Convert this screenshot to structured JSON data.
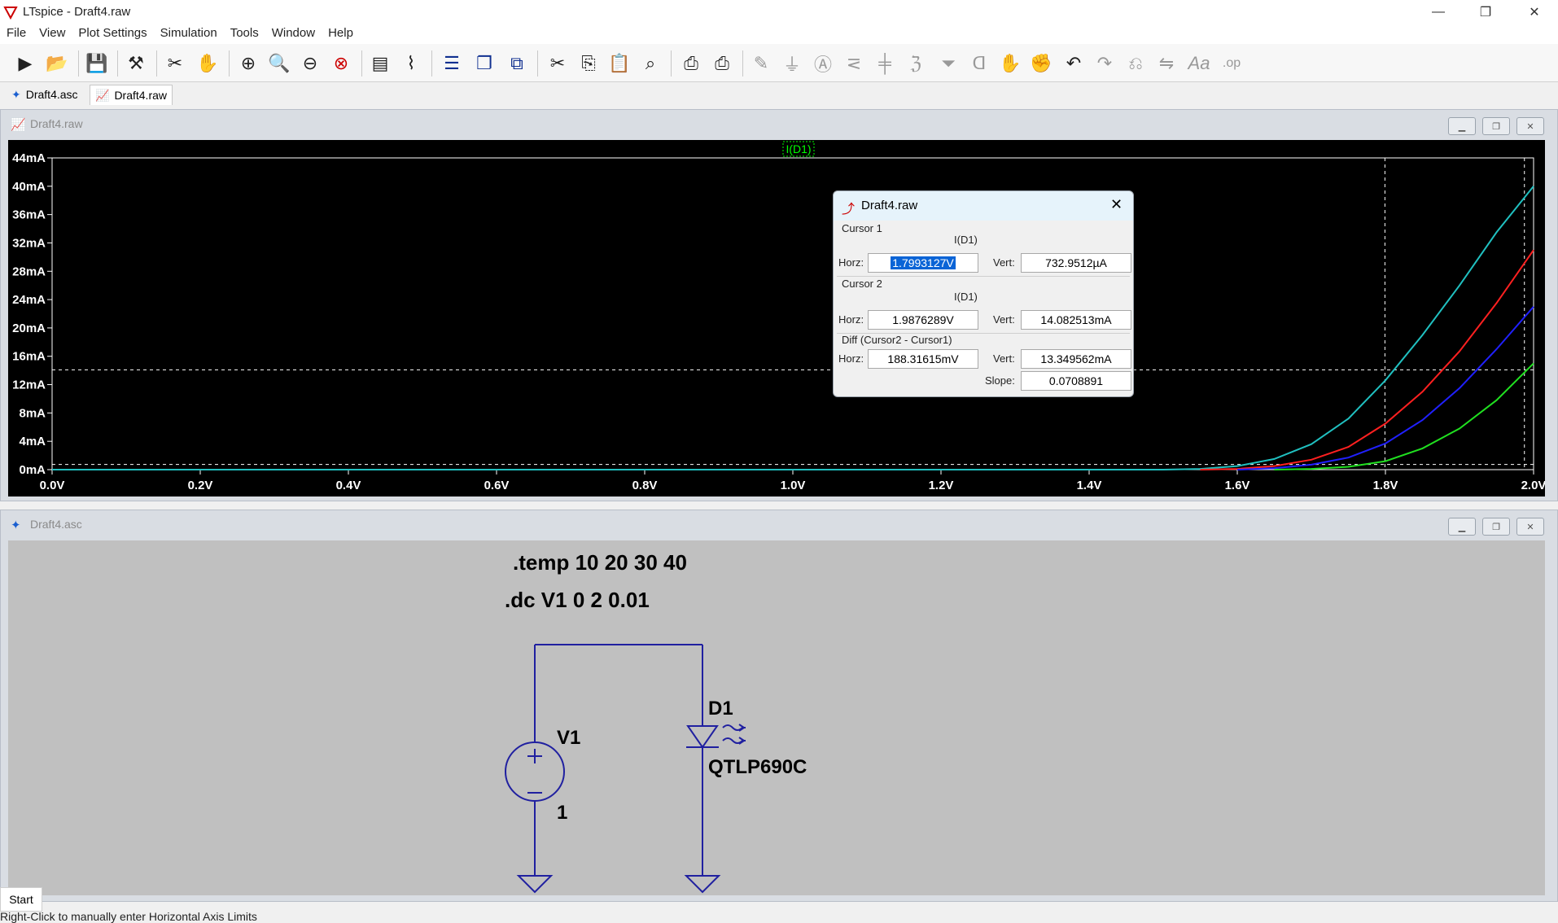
{
  "window": {
    "title": "LTspice - Draft4.raw",
    "controls": [
      "—",
      "❐",
      "✕"
    ]
  },
  "menu": [
    "File",
    "View",
    "Plot Settings",
    "Simulation",
    "Tools",
    "Window",
    "Help"
  ],
  "toolbar_icons": [
    "run-icon",
    "open-icon",
    "save-icon",
    "control-panel-icon",
    "halt-icon",
    "pan-icon",
    "zoom-in-icon",
    "zoom-area-icon",
    "zoom-out-icon",
    "zoom-fit-icon",
    "autorange-icon",
    "waveform-icon",
    "tile-horizontal-icon",
    "cascade-icon",
    "tile-vertical-icon",
    "cut-icon",
    "copy-icon",
    "paste-icon",
    "find-icon",
    "print-icon",
    "print-setup-icon",
    "wire-icon",
    "ground-icon",
    "label-icon",
    "resistor-icon",
    "capacitor-icon",
    "inductor-icon",
    "diode-icon",
    "component-icon",
    "move-icon",
    "drag-icon",
    "undo-icon",
    "redo-icon",
    "rotate-icon",
    "mirror-icon",
    "text-icon",
    "spice-directive-icon"
  ],
  "tabs": [
    {
      "label": "Draft4.asc",
      "active": false
    },
    {
      "label": "Draft4.raw",
      "active": true
    }
  ],
  "plot_window": {
    "title": "Draft4.raw",
    "trace_label": "I(D1)",
    "colors": {
      "bg": "#000000",
      "axis": "#ffffff",
      "cursor": "#ffffff",
      "label": "#00ff00"
    }
  },
  "chart_data": {
    "type": "line",
    "xlabel": "",
    "ylabel": "",
    "x_ticks": [
      "0.0V",
      "0.2V",
      "0.4V",
      "0.6V",
      "0.8V",
      "1.0V",
      "1.2V",
      "1.4V",
      "1.6V",
      "1.8V",
      "2.0V"
    ],
    "y_ticks": [
      "0mA",
      "4mA",
      "8mA",
      "12mA",
      "16mA",
      "20mA",
      "24mA",
      "28mA",
      "32mA",
      "36mA",
      "40mA",
      "44mA"
    ],
    "xlim": [
      0,
      2.0
    ],
    "ylim": [
      0,
      44
    ],
    "series": [
      {
        "color": "#20c0c0",
        "x": [
          1.5,
          1.55,
          1.6,
          1.65,
          1.7,
          1.75,
          1.8,
          1.85,
          1.9,
          1.95,
          2.0
        ],
        "y": [
          0,
          0.1,
          0.5,
          1.5,
          3.6,
          7.2,
          12.6,
          19.0,
          26.0,
          33.5,
          40.0
        ]
      },
      {
        "color": "#ff2020",
        "x": [
          1.55,
          1.6,
          1.65,
          1.7,
          1.75,
          1.8,
          1.85,
          1.9,
          1.95,
          2.0
        ],
        "y": [
          0,
          0.1,
          0.5,
          1.4,
          3.2,
          6.5,
          11.0,
          16.7,
          23.5,
          31.0
        ]
      },
      {
        "color": "#2020ff",
        "x": [
          1.6,
          1.65,
          1.7,
          1.75,
          1.8,
          1.85,
          1.9,
          1.95,
          2.0
        ],
        "y": [
          0,
          0.2,
          0.7,
          1.7,
          3.7,
          7.0,
          11.5,
          17.0,
          23.0
        ]
      },
      {
        "color": "#20e020",
        "x": [
          1.65,
          1.7,
          1.75,
          1.8,
          1.85,
          1.9,
          1.95,
          2.0
        ],
        "y": [
          0,
          0.1,
          0.4,
          1.2,
          3.0,
          5.8,
          9.8,
          15.0
        ]
      }
    ],
    "cursor1": {
      "x": 1.7993127,
      "y": 0.7329512
    },
    "cursor2": {
      "x": 1.9876289,
      "y": 14.082513
    },
    "grid": false
  },
  "cursor_dialog": {
    "title": "Draft4.raw",
    "cursor1_label": "Cursor 1",
    "cursor2_label": "Cursor 2",
    "trace": "I(D1)",
    "diff_label": "Diff (Cursor2 - Cursor1)",
    "horz_label": "Horz:",
    "vert_label": "Vert:",
    "slope_label": "Slope:",
    "c1_horz": "1.7993127V",
    "c1_vert": "732.9512µA",
    "c2_horz": "1.9876289V",
    "c2_vert": "14.082513mA",
    "diff_horz": "188.31615mV",
    "diff_vert": "13.349562mA",
    "slope": "0.0708891"
  },
  "schematic_window": {
    "title": "Draft4.asc",
    "directive1": ".temp 10 20 30 40",
    "directive2": ".dc V1 0 2 0.01",
    "source_name": "V1",
    "source_value": "1",
    "diode_name": "D1",
    "diode_model": "QTLP690C",
    "wire_color": "#2020a0"
  },
  "start_button": "Start",
  "status": "Right-Click to manually enter Horizontal Axis Limits"
}
